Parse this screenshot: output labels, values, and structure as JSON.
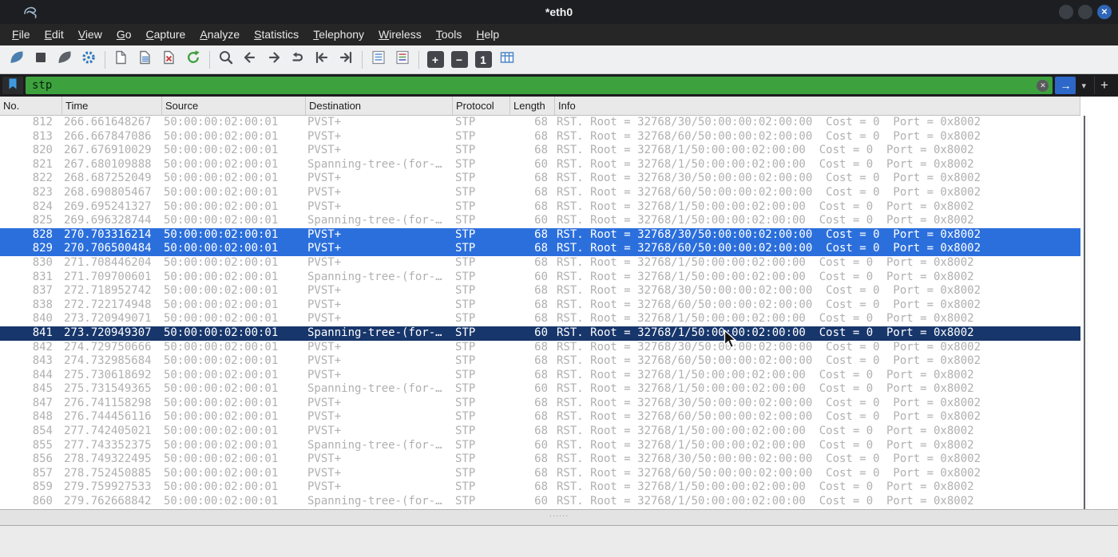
{
  "window": {
    "title": "*eth0",
    "controls": [
      "minimize",
      "maximize",
      "close"
    ]
  },
  "menubar": {
    "items": [
      "File",
      "Edit",
      "View",
      "Go",
      "Capture",
      "Analyze",
      "Statistics",
      "Telephony",
      "Wireless",
      "Tools",
      "Help"
    ]
  },
  "toolbar": {
    "buttons": [
      "start-capture",
      "stop-capture",
      "restart-capture",
      "capture-options",
      "open-file",
      "save-file",
      "close-file",
      "reload-file",
      "find-packet",
      "go-back",
      "go-forward",
      "go-to-packet",
      "first-packet",
      "last-packet",
      "auto-scroll",
      "colorize",
      "zoom-in",
      "zoom-out",
      "zoom-100",
      "resize-columns"
    ]
  },
  "filter": {
    "value": "stp"
  },
  "icons": {
    "close_window": "✕",
    "clear_filter": "✕",
    "apply_arrow": "→",
    "dropdown_chevron": "▾",
    "add_filter_button": "+",
    "zoom_in": "+",
    "zoom_out": "−",
    "zoom_100": "1",
    "splitter_handle": "······"
  },
  "colors": {
    "accent_selected": "#2b6fdc",
    "accent_focused": "#17366b",
    "filter_valid": "#3da23d",
    "row_text": "#b0b0b0"
  },
  "columns": [
    "No.",
    "Time",
    "Source",
    "Destination",
    "Protocol",
    "Length",
    "Info"
  ],
  "packets": [
    {
      "no": "812",
      "time": "266.661648267",
      "src": "50:00:00:02:00:01",
      "dst": "PVST+",
      "proto": "STP",
      "len": "68",
      "info": "RST. Root = 32768/30/50:00:00:02:00:00  Cost = 0  Port = 0x8002",
      "state": "normal"
    },
    {
      "no": "813",
      "time": "266.667847086",
      "src": "50:00:00:02:00:01",
      "dst": "PVST+",
      "proto": "STP",
      "len": "68",
      "info": "RST. Root = 32768/60/50:00:00:02:00:00  Cost = 0  Port = 0x8002",
      "state": "normal"
    },
    {
      "no": "820",
      "time": "267.676910029",
      "src": "50:00:00:02:00:01",
      "dst": "PVST+",
      "proto": "STP",
      "len": "68",
      "info": "RST. Root = 32768/1/50:00:00:02:00:00  Cost = 0  Port = 0x8002",
      "state": "normal"
    },
    {
      "no": "821",
      "time": "267.680109888",
      "src": "50:00:00:02:00:01",
      "dst": "Spanning-tree-(for-…",
      "proto": "STP",
      "len": "60",
      "info": "RST. Root = 32768/1/50:00:00:02:00:00  Cost = 0  Port = 0x8002",
      "state": "normal"
    },
    {
      "no": "822",
      "time": "268.687252049",
      "src": "50:00:00:02:00:01",
      "dst": "PVST+",
      "proto": "STP",
      "len": "68",
      "info": "RST. Root = 32768/30/50:00:00:02:00:00  Cost = 0  Port = 0x8002",
      "state": "normal"
    },
    {
      "no": "823",
      "time": "268.690805467",
      "src": "50:00:00:02:00:01",
      "dst": "PVST+",
      "proto": "STP",
      "len": "68",
      "info": "RST. Root = 32768/60/50:00:00:02:00:00  Cost = 0  Port = 0x8002",
      "state": "normal"
    },
    {
      "no": "824",
      "time": "269.695241327",
      "src": "50:00:00:02:00:01",
      "dst": "PVST+",
      "proto": "STP",
      "len": "68",
      "info": "RST. Root = 32768/1/50:00:00:02:00:00  Cost = 0  Port = 0x8002",
      "state": "normal"
    },
    {
      "no": "825",
      "time": "269.696328744",
      "src": "50:00:00:02:00:01",
      "dst": "Spanning-tree-(for-…",
      "proto": "STP",
      "len": "60",
      "info": "RST. Root = 32768/1/50:00:00:02:00:00  Cost = 0  Port = 0x8002",
      "state": "normal"
    },
    {
      "no": "828",
      "time": "270.703316214",
      "src": "50:00:00:02:00:01",
      "dst": "PVST+",
      "proto": "STP",
      "len": "68",
      "info": "RST. Root = 32768/30/50:00:00:02:00:00  Cost = 0  Port = 0x8002",
      "state": "selected"
    },
    {
      "no": "829",
      "time": "270.706500484",
      "src": "50:00:00:02:00:01",
      "dst": "PVST+",
      "proto": "STP",
      "len": "68",
      "info": "RST. Root = 32768/60/50:00:00:02:00:00  Cost = 0  Port = 0x8002",
      "state": "selected"
    },
    {
      "no": "830",
      "time": "271.708446204",
      "src": "50:00:00:02:00:01",
      "dst": "PVST+",
      "proto": "STP",
      "len": "68",
      "info": "RST. Root = 32768/1/50:00:00:02:00:00  Cost = 0  Port = 0x8002",
      "state": "normal"
    },
    {
      "no": "831",
      "time": "271.709700601",
      "src": "50:00:00:02:00:01",
      "dst": "Spanning-tree-(for-…",
      "proto": "STP",
      "len": "60",
      "info": "RST. Root = 32768/1/50:00:00:02:00:00  Cost = 0  Port = 0x8002",
      "state": "normal"
    },
    {
      "no": "837",
      "time": "272.718952742",
      "src": "50:00:00:02:00:01",
      "dst": "PVST+",
      "proto": "STP",
      "len": "68",
      "info": "RST. Root = 32768/30/50:00:00:02:00:00  Cost = 0  Port = 0x8002",
      "state": "normal"
    },
    {
      "no": "838",
      "time": "272.722174948",
      "src": "50:00:00:02:00:01",
      "dst": "PVST+",
      "proto": "STP",
      "len": "68",
      "info": "RST. Root = 32768/60/50:00:00:02:00:00  Cost = 0  Port = 0x8002",
      "state": "normal"
    },
    {
      "no": "840",
      "time": "273.720949071",
      "src": "50:00:00:02:00:01",
      "dst": "PVST+",
      "proto": "STP",
      "len": "68",
      "info": "RST. Root = 32768/1/50:00:00:02:00:00  Cost = 0  Port = 0x8002",
      "state": "normal"
    },
    {
      "no": "841",
      "time": "273.720949307",
      "src": "50:00:00:02:00:01",
      "dst": "Spanning-tree-(for-…",
      "proto": "STP",
      "len": "60",
      "info": "RST. Root = 32768/1/50:00:00:02:00:00  Cost = 0  Port = 0x8002",
      "state": "focused"
    },
    {
      "no": "842",
      "time": "274.729750666",
      "src": "50:00:00:02:00:01",
      "dst": "PVST+",
      "proto": "STP",
      "len": "68",
      "info": "RST. Root = 32768/30/50:00:00:02:00:00  Cost = 0  Port = 0x8002",
      "state": "normal"
    },
    {
      "no": "843",
      "time": "274.732985684",
      "src": "50:00:00:02:00:01",
      "dst": "PVST+",
      "proto": "STP",
      "len": "68",
      "info": "RST. Root = 32768/60/50:00:00:02:00:00  Cost = 0  Port = 0x8002",
      "state": "normal"
    },
    {
      "no": "844",
      "time": "275.730618692",
      "src": "50:00:00:02:00:01",
      "dst": "PVST+",
      "proto": "STP",
      "len": "68",
      "info": "RST. Root = 32768/1/50:00:00:02:00:00  Cost = 0  Port = 0x8002",
      "state": "normal"
    },
    {
      "no": "845",
      "time": "275.731549365",
      "src": "50:00:00:02:00:01",
      "dst": "Spanning-tree-(for-…",
      "proto": "STP",
      "len": "60",
      "info": "RST. Root = 32768/1/50:00:00:02:00:00  Cost = 0  Port = 0x8002",
      "state": "normal"
    },
    {
      "no": "847",
      "time": "276.741158298",
      "src": "50:00:00:02:00:01",
      "dst": "PVST+",
      "proto": "STP",
      "len": "68",
      "info": "RST. Root = 32768/30/50:00:00:02:00:00  Cost = 0  Port = 0x8002",
      "state": "normal"
    },
    {
      "no": "848",
      "time": "276.744456116",
      "src": "50:00:00:02:00:01",
      "dst": "PVST+",
      "proto": "STP",
      "len": "68",
      "info": "RST. Root = 32768/60/50:00:00:02:00:00  Cost = 0  Port = 0x8002",
      "state": "normal"
    },
    {
      "no": "854",
      "time": "277.742405021",
      "src": "50:00:00:02:00:01",
      "dst": "PVST+",
      "proto": "STP",
      "len": "68",
      "info": "RST. Root = 32768/1/50:00:00:02:00:00  Cost = 0  Port = 0x8002",
      "state": "normal"
    },
    {
      "no": "855",
      "time": "277.743352375",
      "src": "50:00:00:02:00:01",
      "dst": "Spanning-tree-(for-…",
      "proto": "STP",
      "len": "60",
      "info": "RST. Root = 32768/1/50:00:00:02:00:00  Cost = 0  Port = 0x8002",
      "state": "normal"
    },
    {
      "no": "856",
      "time": "278.749322495",
      "src": "50:00:00:02:00:01",
      "dst": "PVST+",
      "proto": "STP",
      "len": "68",
      "info": "RST. Root = 32768/30/50:00:00:02:00:00  Cost = 0  Port = 0x8002",
      "state": "normal"
    },
    {
      "no": "857",
      "time": "278.752450885",
      "src": "50:00:00:02:00:01",
      "dst": "PVST+",
      "proto": "STP",
      "len": "68",
      "info": "RST. Root = 32768/60/50:00:00:02:00:00  Cost = 0  Port = 0x8002",
      "state": "normal"
    },
    {
      "no": "859",
      "time": "279.759927533",
      "src": "50:00:00:02:00:01",
      "dst": "PVST+",
      "proto": "STP",
      "len": "68",
      "info": "RST. Root = 32768/1/50:00:00:02:00:00  Cost = 0  Port = 0x8002",
      "state": "normal"
    },
    {
      "no": "860",
      "time": "279.762668842",
      "src": "50:00:00:02:00:01",
      "dst": "Spanning-tree-(for-…",
      "proto": "STP",
      "len": "60",
      "info": "RST. Root = 32768/1/50:00:00:02:00:00  Cost = 0  Port = 0x8002",
      "state": "normal"
    }
  ]
}
